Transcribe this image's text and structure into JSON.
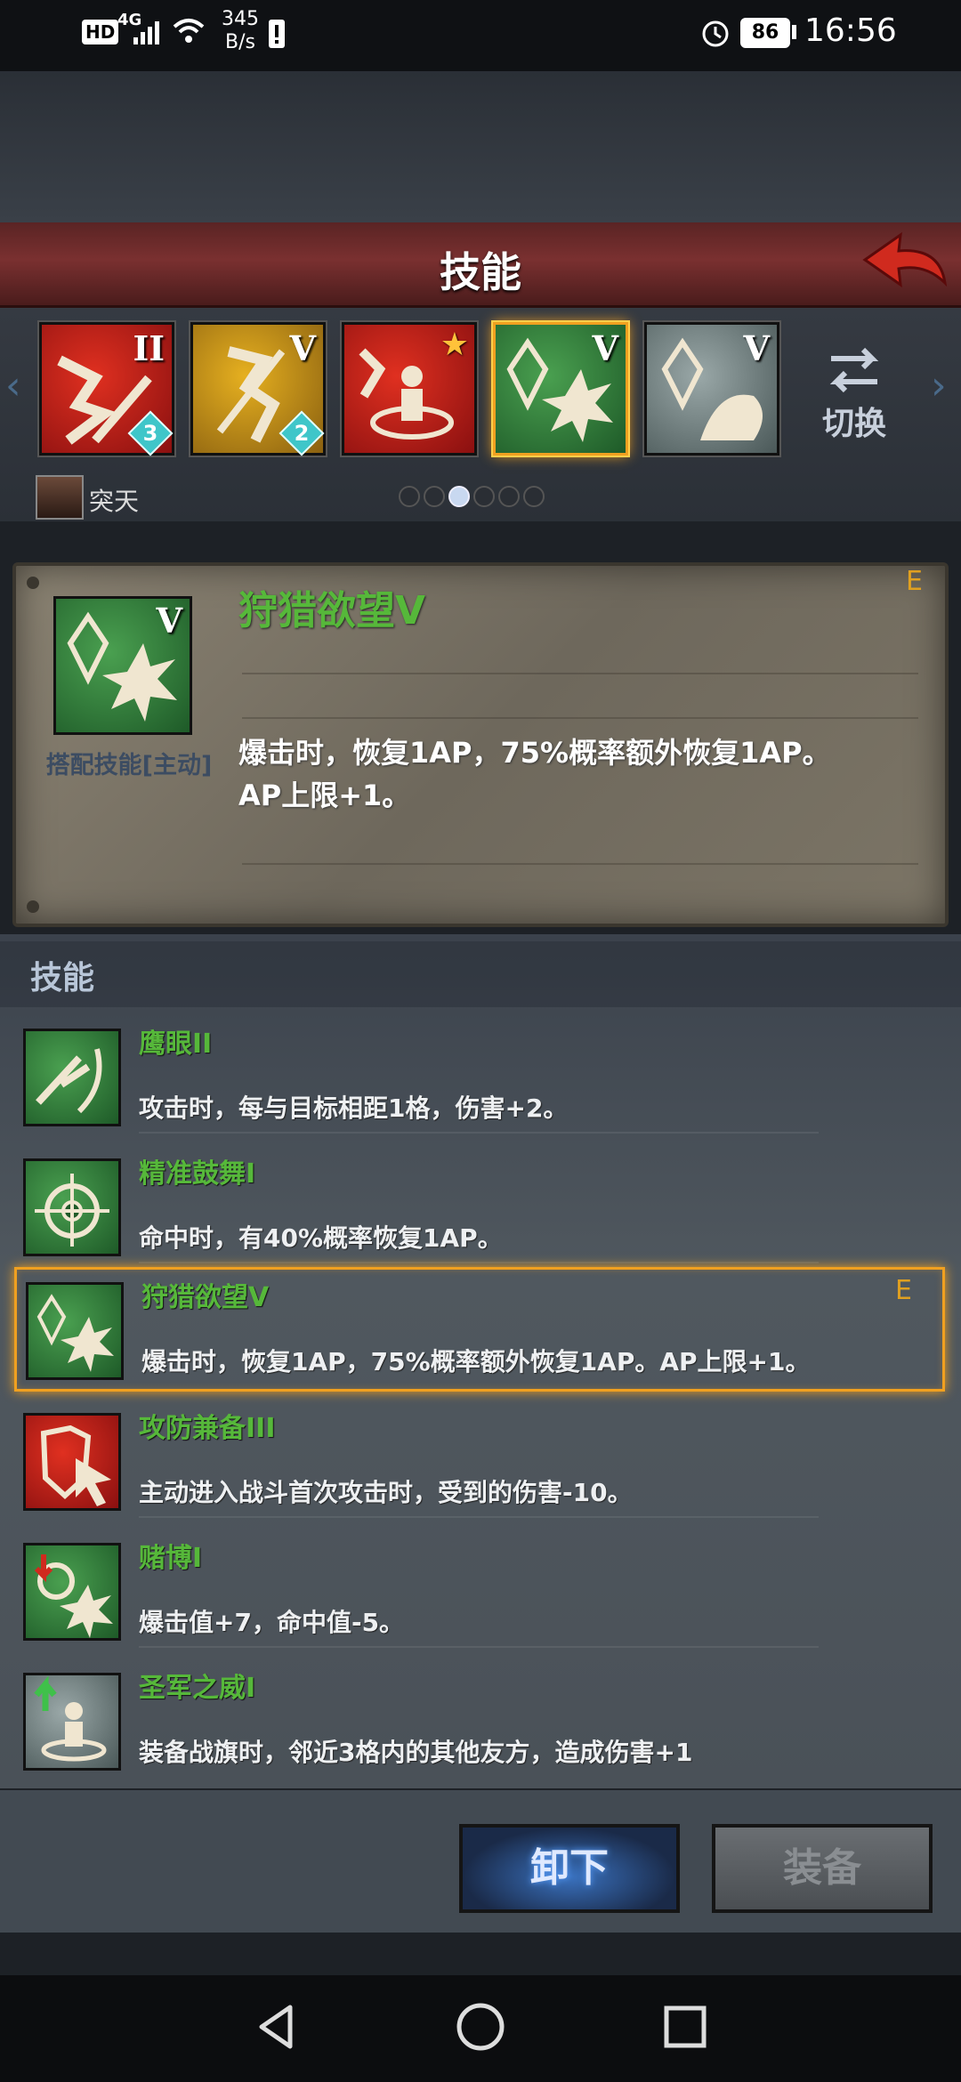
{
  "status_bar": {
    "network_hd": "HD",
    "network_gen": "4G",
    "speed_value": "345",
    "speed_unit": "B/s",
    "battery": "86",
    "time": "16:56",
    "icons": [
      "signal-icon",
      "wifi-icon",
      "alert-icon",
      "alarm-icon",
      "battery-icon"
    ]
  },
  "header": {
    "title": "技能",
    "back_icon": "back-arrow-icon"
  },
  "skill_bar": {
    "slots": [
      {
        "level": "II",
        "badge": "3",
        "color": "red",
        "icon": "sword-broken-icon"
      },
      {
        "level": "V",
        "badge": "2",
        "color": "gold",
        "icon": "axe-icon"
      },
      {
        "level": "",
        "badge": "",
        "color": "red",
        "icon": "hero-aura-icon",
        "star": true
      },
      {
        "level": "V",
        "badge": "",
        "color": "green",
        "icon": "crystal-burst-icon",
        "selected": true
      },
      {
        "level": "V",
        "badge": "",
        "color": "gray",
        "icon": "crystal-hand-icon"
      }
    ],
    "switch_label": "切换",
    "hero_name": "突天",
    "page_dots": 6,
    "active_dot": 2
  },
  "detail": {
    "name": "狩猎欲望V",
    "grade": "E",
    "level": "V",
    "tag": "搭配技能[主动]",
    "desc_line1": "爆击时，恢复1AP，75%概率额外恢复1AP。",
    "desc_line2": "AP上限+1。"
  },
  "list": {
    "title": "技能",
    "items": [
      {
        "name": "鹰眼II",
        "desc": "攻击时，每与目标相距1格，伤害+2。",
        "icon": "eagle-eye-icon",
        "color": "green"
      },
      {
        "name": "精准鼓舞I",
        "desc": "命中时，有40%概率恢复1AP。",
        "icon": "crosshair-icon",
        "color": "green"
      },
      {
        "name": "狩猎欲望V",
        "desc": "爆击时，恢复1AP，75%概率额外恢复1AP。AP上限+1。",
        "icon": "crystal-burst-icon",
        "color": "green",
        "grade": "E",
        "selected": true
      },
      {
        "name": "攻防兼备III",
        "desc": "主动进入战斗首次攻击时，受到的伤害-10。",
        "icon": "shield-cursor-icon",
        "color": "red"
      },
      {
        "name": "赌博I",
        "desc": "爆击值+7，命中值-5。",
        "icon": "gamble-icon",
        "color": "green"
      },
      {
        "name": "圣军之威I",
        "desc": "装备战旗时，邻近3格内的其他友方，造成伤害+1",
        "icon": "banner-icon",
        "color": "gray"
      }
    ]
  },
  "buttons": {
    "unequip": "卸下",
    "equip": "装备"
  },
  "nav": {
    "icons": [
      "back-triangle-icon",
      "home-circle-icon",
      "recent-square-icon"
    ]
  },
  "colors": {
    "skill_name": "#56b83a",
    "grade": "#e0a020",
    "selection": "#f0a020",
    "title_bar": "#7a3030"
  }
}
